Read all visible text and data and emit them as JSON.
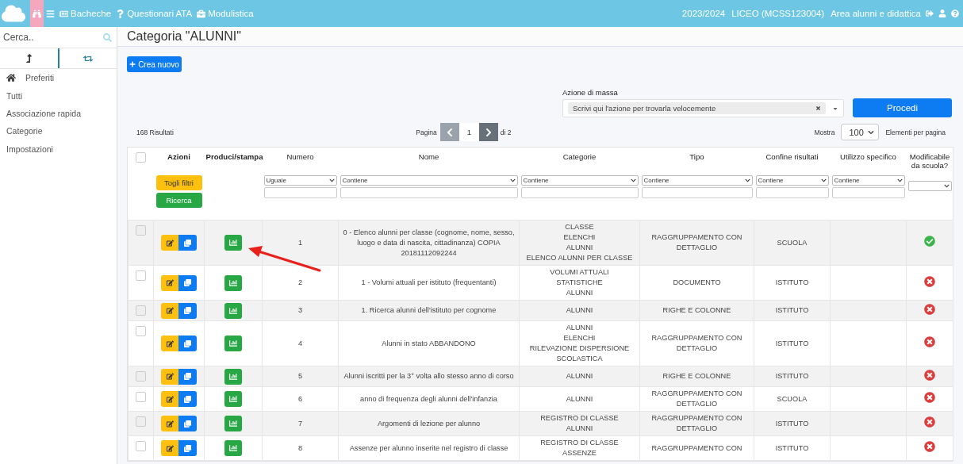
{
  "topbar": {
    "nav": [
      {
        "kind": "binoculars",
        "selected": true
      },
      {
        "kind": "menu"
      },
      {
        "kind": "board",
        "label": "Bacheche"
      },
      {
        "kind": "question",
        "label": "Questionari ATA"
      },
      {
        "kind": "briefcase",
        "label": "Modulistica"
      }
    ],
    "info": [
      "2023/2024",
      "LICEO (MCSS123004)",
      "Area alunni e didattica"
    ]
  },
  "sidebar": {
    "search": {
      "placeholder": "Cerca.."
    },
    "tabs": [
      {
        "kind": "up",
        "selected": true
      },
      {
        "kind": "retweet",
        "selected": false
      }
    ],
    "items": [
      {
        "label": "Preferiti",
        "kind": "home"
      },
      {
        "label": "Tutti"
      },
      {
        "label": "Associazione rapida"
      },
      {
        "label": "Categorie"
      },
      {
        "label": "Impostazioni"
      }
    ]
  },
  "page": {
    "title": "Categoria \"ALUNNI\"",
    "create_button": "Crea nuovo",
    "mass_action": {
      "label": "Azione di massa",
      "placeholder": "Scrivi qui l'azione per trovarla velocemente",
      "button": "Procedi"
    },
    "results": "168 Risultati",
    "pagination": {
      "label": "Pagina",
      "page": "1",
      "of": "di 2"
    },
    "page_size": {
      "label": "Mostra",
      "value": "100",
      "suffix": "Elementi per pagina"
    }
  },
  "table": {
    "select_all": {
      "checked": false
    },
    "columns": [
      "Azioni",
      "Produci/stampa",
      "Numero",
      "Nome",
      "Categorie",
      "Tipo",
      "Confine risultati",
      "Utilizzo specifico",
      "Modificabile da scuola?"
    ],
    "filter_buttons": [
      "Togli filtri",
      "Ricerca"
    ],
    "filters": [
      {
        "kind": "text",
        "operator": "Uguale"
      },
      {
        "kind": "text",
        "operator": "Contiene"
      },
      {
        "kind": "text",
        "operator": "Contiene"
      },
      {
        "kind": "text",
        "operator": "Contiene"
      },
      {
        "kind": "text",
        "operator": "Contiene"
      },
      {
        "kind": "text",
        "operator": "Contiene"
      },
      {
        "kind": "select"
      }
    ],
    "rows": [
      {
        "checked": false,
        "numero": "1",
        "nome": "0 - Elenco alunni per classe (cognome, nome, sesso, luogo e data di nascita, cittadinanza) COPIA 20181112092244",
        "categorie": [
          "CLASSE",
          "ELENCHI",
          "ALUNNI",
          "ELENCO ALUNNI PER CLASSE"
        ],
        "tipo": "RAGGRUPPAMENTO CON DETTAGLIO",
        "confine": "SCUOLA",
        "modificabile": true
      },
      {
        "checked": false,
        "numero": "2",
        "nome": "1 - Volumi attuali per istituto (frequentanti)",
        "categorie": [
          "VOLUMI ATTUALI",
          "STATISTICHE",
          "ALUNNI"
        ],
        "tipo": "DOCUMENTO",
        "confine": "ISTITUTO",
        "modificabile": false
      },
      {
        "checked": false,
        "numero": "3",
        "nome": "1. Ricerca alunni dell'istituto per cognome",
        "categorie": [
          "ALUNNI"
        ],
        "tipo": "RIGHE E COLONNE",
        "confine": "ISTITUTO",
        "modificabile": false
      },
      {
        "checked": false,
        "numero": "4",
        "nome": "Alunni in stato ABBANDONO",
        "categorie": [
          "ALUNNI",
          "ELENCHI",
          "RILEVAZIONE DISPERSIONE SCOLASTICA"
        ],
        "tipo": "RAGGRUPPAMENTO CON DETTAGLIO",
        "confine": "ISTITUTO",
        "modificabile": false
      },
      {
        "checked": false,
        "numero": "5",
        "nome": "Alunni iscritti per la 3° volta allo stesso anno di corso",
        "categorie": [
          "ALUNNI"
        ],
        "tipo": "RIGHE E COLONNE",
        "confine": "ISTITUTO",
        "modificabile": false
      },
      {
        "checked": false,
        "numero": "6",
        "nome": "anno di frequenza degli alunni dell'infanzia",
        "categorie": [
          "ALUNNI"
        ],
        "tipo": "RAGGRUPPAMENTO CON DETTAGLIO",
        "confine": "SCUOLA",
        "modificabile": false
      },
      {
        "checked": false,
        "numero": "7",
        "nome": "Argomenti di lezione per alunno",
        "categorie": [
          "REGISTRO DI CLASSE",
          "ALUNNI"
        ],
        "tipo": "RAGGRUPPAMENTO CON DETTAGLIO",
        "confine": "ISTITUTO",
        "modificabile": false
      },
      {
        "checked": false,
        "numero": "8",
        "nome": "Assenze per alunno inserite nel registro di classe",
        "categorie": [
          "REGISTRO DI CLASSE",
          "ASSENZE"
        ],
        "tipo": "RAGGRUPPAMENTO CON",
        "confine": "ISTITUTO",
        "modificabile": false
      }
    ]
  }
}
